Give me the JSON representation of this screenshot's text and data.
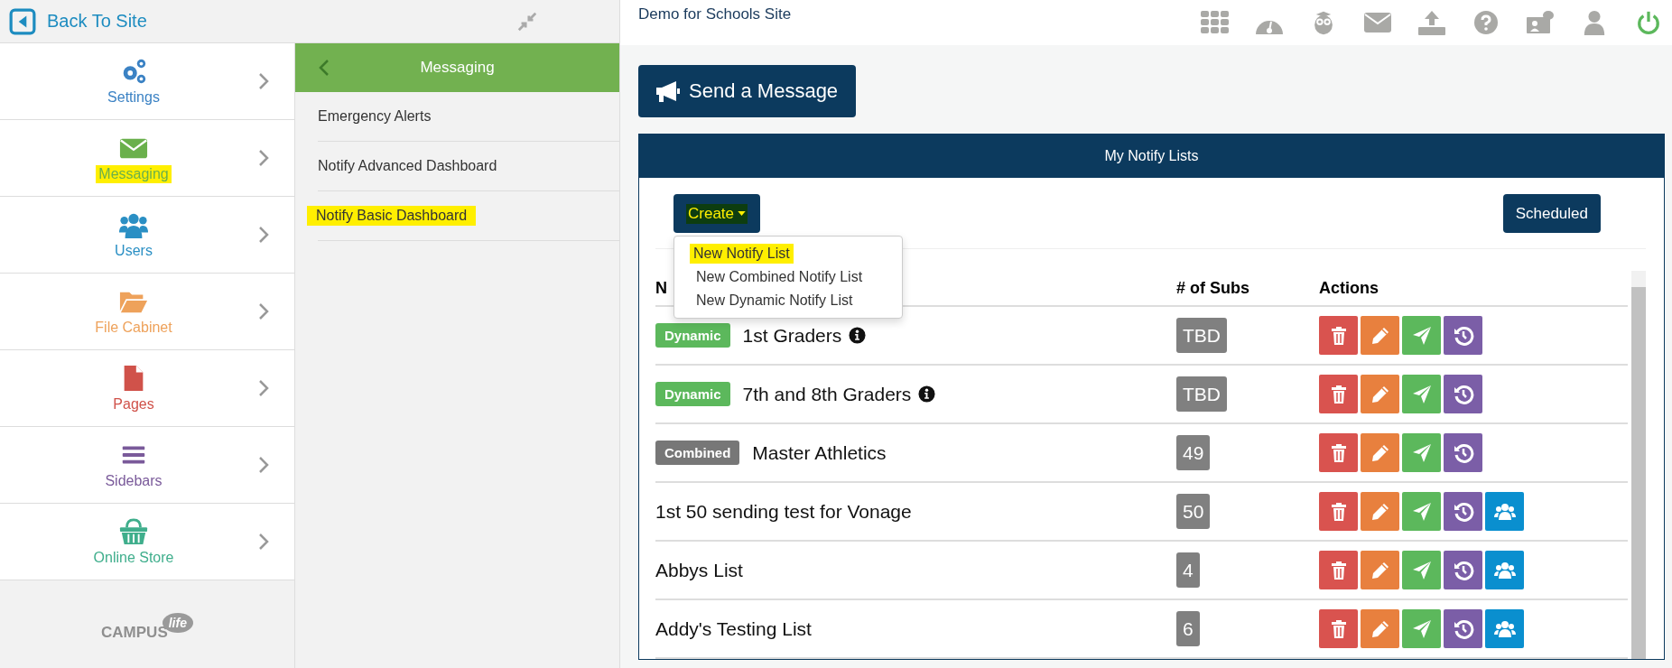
{
  "back_link": {
    "label": "Back To Site"
  },
  "nav": [
    {
      "label": "Settings",
      "kind": "settings",
      "color": "#3b82c4",
      "highlighted": false
    },
    {
      "label": "Messaging",
      "kind": "messaging",
      "color": "#6ab04c",
      "highlighted": true
    },
    {
      "label": "Users",
      "kind": "users",
      "color": "#2a8fc4",
      "highlighted": false
    },
    {
      "label": "File Cabinet",
      "kind": "files",
      "color": "#eea25b",
      "highlighted": false
    },
    {
      "label": "Pages",
      "kind": "pages",
      "color": "#d0524a",
      "highlighted": false
    },
    {
      "label": "Sidebars",
      "kind": "sidebars",
      "color": "#7a5a9a",
      "highlighted": false
    },
    {
      "label": "Online Store",
      "kind": "store",
      "color": "#3fae8c",
      "highlighted": false
    }
  ],
  "logo": {
    "text": "CAMPUS",
    "badge": "life"
  },
  "subpanel": {
    "title": "Messaging",
    "items": [
      {
        "label": "Emergency Alerts",
        "highlighted": false
      },
      {
        "label": "Notify Advanced Dashboard",
        "highlighted": false
      },
      {
        "label": "Notify Basic Dashboard",
        "highlighted": true
      }
    ]
  },
  "site_title": "Demo for Schools Site",
  "send_button": {
    "label": "Send a Message"
  },
  "panel": {
    "title": "My Notify Lists",
    "create_button": {
      "label": "Create",
      "highlighted": true
    },
    "create_menu": [
      {
        "label": "New Notify List",
        "highlighted": true
      },
      {
        "label": "New Combined Notify List",
        "highlighted": false
      },
      {
        "label": "New Dynamic Notify List",
        "highlighted": false
      }
    ],
    "scheduled_button": {
      "label": "Scheduled"
    },
    "table": {
      "columns": [
        "N",
        "# of Subs",
        "Actions"
      ],
      "rows": [
        {
          "tag": {
            "label": "Dynamic",
            "kind": "dynamic"
          },
          "name": "1st Graders",
          "info": true,
          "subs": "TBD",
          "actions": [
            {
              "kind": "delete"
            },
            {
              "kind": "edit"
            },
            {
              "kind": "send"
            },
            {
              "kind": "history"
            }
          ]
        },
        {
          "tag": {
            "label": "Dynamic",
            "kind": "dynamic"
          },
          "name": "7th and 8th Graders",
          "info": true,
          "subs": "TBD",
          "actions": [
            {
              "kind": "delete"
            },
            {
              "kind": "edit"
            },
            {
              "kind": "send"
            },
            {
              "kind": "history"
            }
          ]
        },
        {
          "tag": {
            "label": "Combined",
            "kind": "combined"
          },
          "name": "Master Athletics",
          "info": false,
          "subs": "49",
          "actions": [
            {
              "kind": "delete"
            },
            {
              "kind": "edit"
            },
            {
              "kind": "send"
            },
            {
              "kind": "history"
            }
          ]
        },
        {
          "name": "1st 50 sending test for Vonage",
          "info": false,
          "subs": "50",
          "actions": [
            {
              "kind": "delete"
            },
            {
              "kind": "edit"
            },
            {
              "kind": "send"
            },
            {
              "kind": "history"
            },
            {
              "kind": "members"
            }
          ]
        },
        {
          "name": "Abbys List",
          "info": false,
          "subs": "4",
          "actions": [
            {
              "kind": "delete"
            },
            {
              "kind": "edit"
            },
            {
              "kind": "send"
            },
            {
              "kind": "history"
            },
            {
              "kind": "members"
            }
          ]
        },
        {
          "name": "Addy's Testing List",
          "info": false,
          "subs": "6",
          "actions": [
            {
              "kind": "delete"
            },
            {
              "kind": "edit"
            },
            {
              "kind": "send"
            },
            {
              "kind": "history"
            },
            {
              "kind": "members"
            }
          ]
        }
      ]
    }
  }
}
